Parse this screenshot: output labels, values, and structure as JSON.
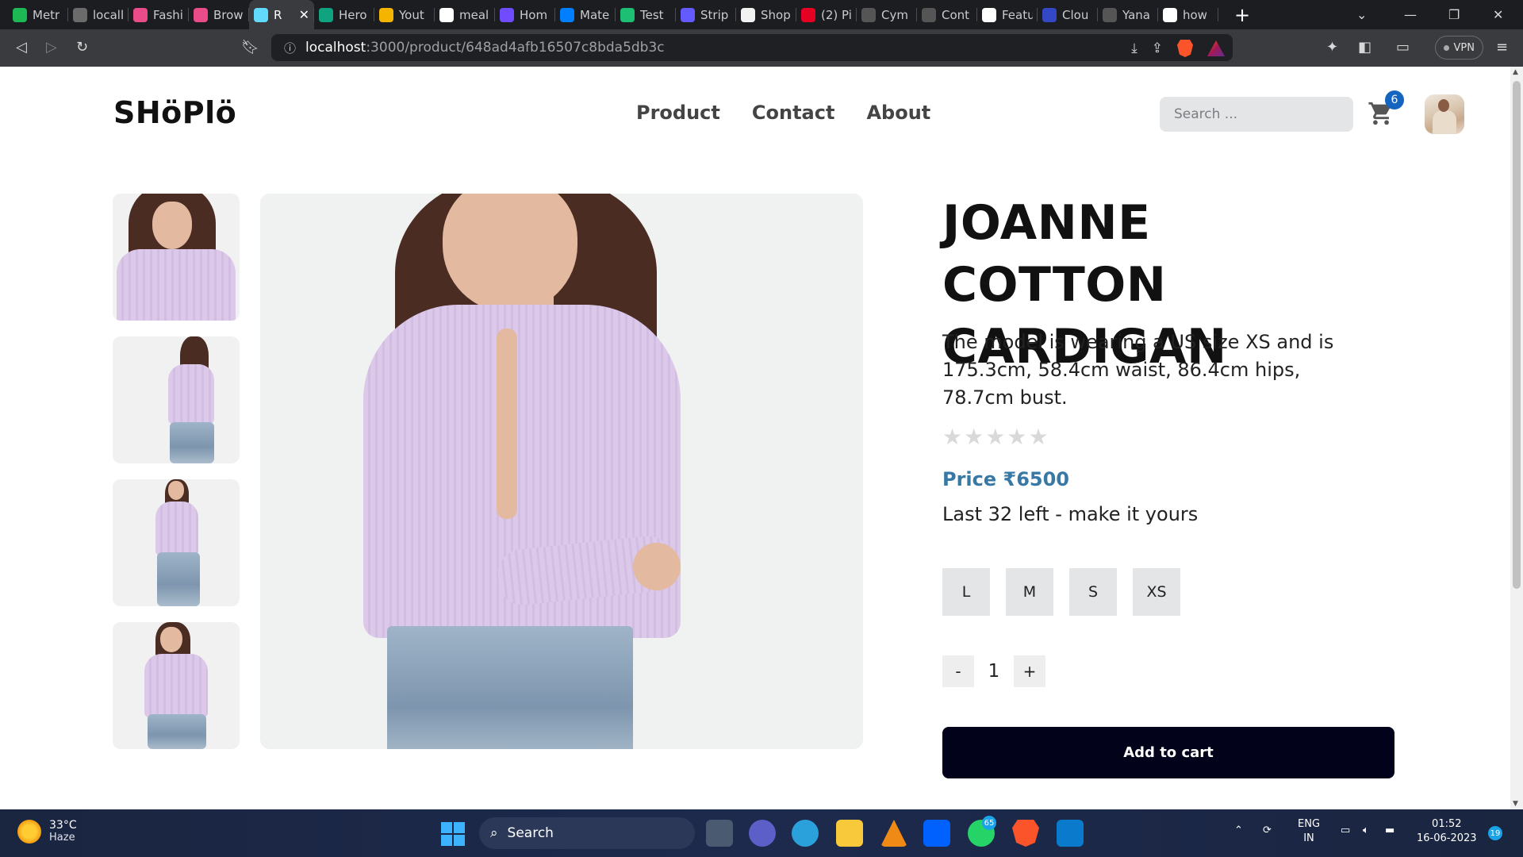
{
  "browser": {
    "tabs": [
      {
        "label": "Metr",
        "color": "#1db954",
        "icon": "leaf-icon"
      },
      {
        "label": "locall",
        "color": "#6b6b6b",
        "icon": "grid-icon"
      },
      {
        "label": "Fashi",
        "color": "#ea4c89",
        "icon": "dribbble-icon"
      },
      {
        "label": "Brow",
        "color": "#ea4c89",
        "icon": "dribbble-icon"
      },
      {
        "label": "R",
        "color": "#61dafb",
        "icon": "react-icon",
        "active": true
      },
      {
        "label": "Hero",
        "color": "#10a37f",
        "icon": "openai-icon"
      },
      {
        "label": "Yout",
        "color": "#f5b400",
        "icon": "fire-icon"
      },
      {
        "label": "meal",
        "color": "#ffffff",
        "icon": "github-icon"
      },
      {
        "label": "Hom",
        "color": "#6f4dff",
        "icon": "s-icon"
      },
      {
        "label": "Mate",
        "color": "#007fff",
        "icon": "mui-icon"
      },
      {
        "label": "Test",
        "color": "#1dbf73",
        "icon": "s-icon"
      },
      {
        "label": "Strip",
        "color": "#635bff",
        "icon": "s-icon"
      },
      {
        "label": "Shop",
        "color": "#f2f2f2",
        "icon": "bag-icon"
      },
      {
        "label": "(2) Pi",
        "color": "#e60023",
        "icon": "pinterest-icon"
      },
      {
        "label": "Cym",
        "color": "#555555",
        "icon": "cube-icon"
      },
      {
        "label": "Cont",
        "color": "#555555",
        "icon": "slash-icon"
      },
      {
        "label": "Featu",
        "color": "#ffffff",
        "icon": "ref-icon"
      },
      {
        "label": "Clou",
        "color": "#3448c5",
        "icon": "cloud-icon"
      },
      {
        "label": "Yana",
        "color": "#555555",
        "icon": "github-icon"
      },
      {
        "label": "how",
        "color": "#ffffff",
        "icon": "google-icon"
      }
    ],
    "url_host": "localhost",
    "url_path": ":3000/product/648ad4afb16507c8bda5db3c",
    "vpn_label": "VPN"
  },
  "header": {
    "logo": "SHöPlö",
    "nav": [
      "Product",
      "Contact",
      "About"
    ],
    "search_placeholder": "Search ...",
    "cart_count": "6"
  },
  "product": {
    "title": "JOANNE COTTON CARDIGAN",
    "description": "The model is wearing a US size XS and is 175.3cm, 58.4cm waist, 86.4cm hips, 78.7cm bust.",
    "rating": 0,
    "rating_max": 5,
    "price": "Price ₹6500",
    "stock": "Last 32 left - make it yours",
    "sizes": [
      "L",
      "M",
      "S",
      "XS"
    ],
    "quantity": "1",
    "minus": "-",
    "plus": "+",
    "add_to_cart": "Add to cart",
    "colors": {
      "accent": "#3778a5",
      "button": "#02021a",
      "badge": "#1565c0"
    }
  },
  "taskbar": {
    "temp": "33°C",
    "weather": "Haze",
    "search": "Search",
    "whatsapp_badge": "65",
    "lang1": "ENG",
    "lang2": "IN",
    "time": "01:52",
    "date": "16-06-2023",
    "notif": "19"
  }
}
